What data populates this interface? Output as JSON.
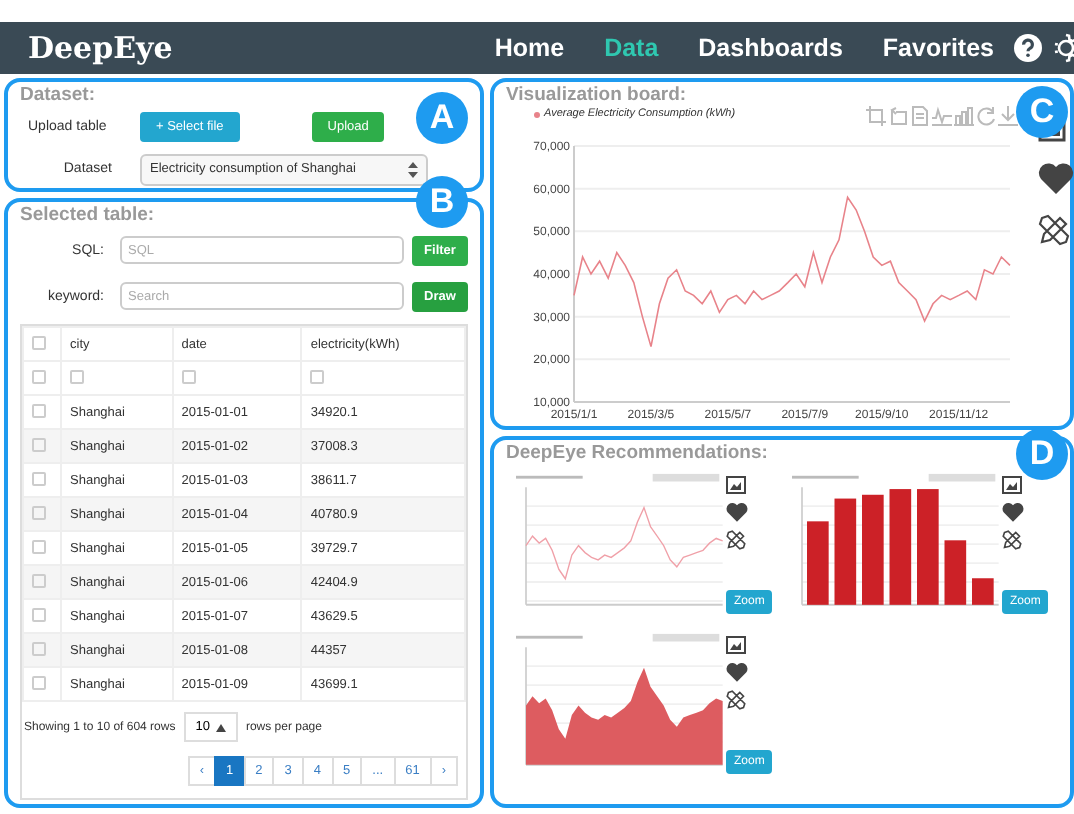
{
  "app": {
    "logo": "DeepEye"
  },
  "nav": {
    "items": [
      {
        "label": "Home",
        "selected": false
      },
      {
        "label": "Data",
        "selected": true
      },
      {
        "label": "Dashboards",
        "selected": false
      },
      {
        "label": "Favorites",
        "selected": false
      }
    ]
  },
  "dataset": {
    "marker": "A",
    "title": "Dataset:",
    "upload_label": "Upload table",
    "select_button": "+ Select file",
    "upload_button": "Upload",
    "dataset_label": "Dataset",
    "dataset_value": "Electricity consumption of Shanghai"
  },
  "selected_table": {
    "marker": "B",
    "title": "Selected table:",
    "sql_label": "SQL:",
    "sql_placeholder": "SQL",
    "filter_button": "Filter",
    "keyword_label": "keyword:",
    "keyword_placeholder": "Search",
    "draw_button": "Draw",
    "header_checked": false,
    "columns": [
      "city",
      "date",
      "electricity(kWh)"
    ],
    "filter_checks": [
      false,
      false,
      false,
      false
    ],
    "rows": [
      {
        "checked": false,
        "cells": [
          "Shanghai",
          "2015-01-01",
          "34920.1"
        ]
      },
      {
        "checked": false,
        "cells": [
          "Shanghai",
          "2015-01-02",
          "37008.3"
        ]
      },
      {
        "checked": false,
        "cells": [
          "Shanghai",
          "2015-01-03",
          "38611.7"
        ]
      },
      {
        "checked": false,
        "cells": [
          "Shanghai",
          "2015-01-04",
          "40780.9"
        ]
      },
      {
        "checked": false,
        "cells": [
          "Shanghai",
          "2015-01-05",
          "39729.7"
        ]
      },
      {
        "checked": false,
        "cells": [
          "Shanghai",
          "2015-01-06",
          "42404.9"
        ]
      },
      {
        "checked": false,
        "cells": [
          "Shanghai",
          "2015-01-07",
          "43629.5"
        ]
      },
      {
        "checked": false,
        "cells": [
          "Shanghai",
          "2015-01-08",
          "44357"
        ]
      },
      {
        "checked": false,
        "cells": [
          "Shanghai",
          "2015-01-09",
          "43699.1"
        ]
      }
    ],
    "footer": "Showing 1 to 10 of 604 rows",
    "page_size": "10",
    "page_size_suffix": "rows per page",
    "pages": [
      {
        "label": "‹",
        "selected": false
      },
      {
        "label": "1",
        "selected": true
      },
      {
        "label": "2",
        "selected": false
      },
      {
        "label": "3",
        "selected": false
      },
      {
        "label": "4",
        "selected": false
      },
      {
        "label": "5",
        "selected": false
      },
      {
        "label": "...",
        "selected": false
      },
      {
        "label": "61",
        "selected": false
      },
      {
        "label": "›",
        "selected": false
      }
    ]
  },
  "visualization": {
    "marker": "C",
    "title": "Visualization board:",
    "chart_data": {
      "type": "line",
      "ylim": [
        10000,
        70000
      ],
      "yticks": [
        {
          "value": 10000,
          "label": "10,000"
        },
        {
          "value": 20000,
          "label": "20,000"
        },
        {
          "value": 30000,
          "label": "30,000"
        },
        {
          "value": 40000,
          "label": "40,000"
        },
        {
          "value": 50000,
          "label": "50,000"
        },
        {
          "value": 60000,
          "label": "60,000"
        },
        {
          "value": 70000,
          "label": "70,000"
        }
      ],
      "grid": true,
      "categories": [
        "2015/1/1",
        null,
        null,
        null,
        null,
        null,
        null,
        null,
        null,
        "2015/3/5",
        null,
        null,
        null,
        null,
        null,
        null,
        null,
        null,
        "2015/5/7",
        null,
        null,
        null,
        null,
        null,
        null,
        null,
        null,
        "2015/7/9",
        null,
        null,
        null,
        null,
        null,
        null,
        null,
        null,
        "2015/9/10",
        null,
        null,
        null,
        null,
        null,
        null,
        null,
        null,
        "2015/11/12",
        null,
        null,
        null,
        null,
        null,
        null
      ],
      "series": [
        {
          "name": "Average Electricity Consumption (kWh)",
          "color": "#e8838a",
          "values": [
            35000,
            44000,
            40000,
            43000,
            39000,
            45000,
            42000,
            38000,
            30000,
            23000,
            33000,
            39000,
            41000,
            36000,
            35000,
            33000,
            36000,
            31000,
            34000,
            35000,
            33000,
            36000,
            34000,
            35000,
            36000,
            38000,
            40000,
            37000,
            45000,
            38000,
            44000,
            48000,
            58000,
            55000,
            50000,
            44000,
            42000,
            43000,
            38000,
            36000,
            34000,
            29000,
            33000,
            35000,
            34000,
            35000,
            36000,
            34000,
            41000,
            40000,
            44000,
            42000
          ]
        }
      ]
    }
  },
  "recommendations": {
    "marker": "D",
    "title": "DeepEye Recommendations:",
    "cards": [
      {
        "kind": "line",
        "zoom_button": "Zoom"
      },
      {
        "kind": "bar",
        "zoom_button": "Zoom"
      },
      {
        "kind": "area",
        "zoom_button": "Zoom"
      }
    ]
  }
}
